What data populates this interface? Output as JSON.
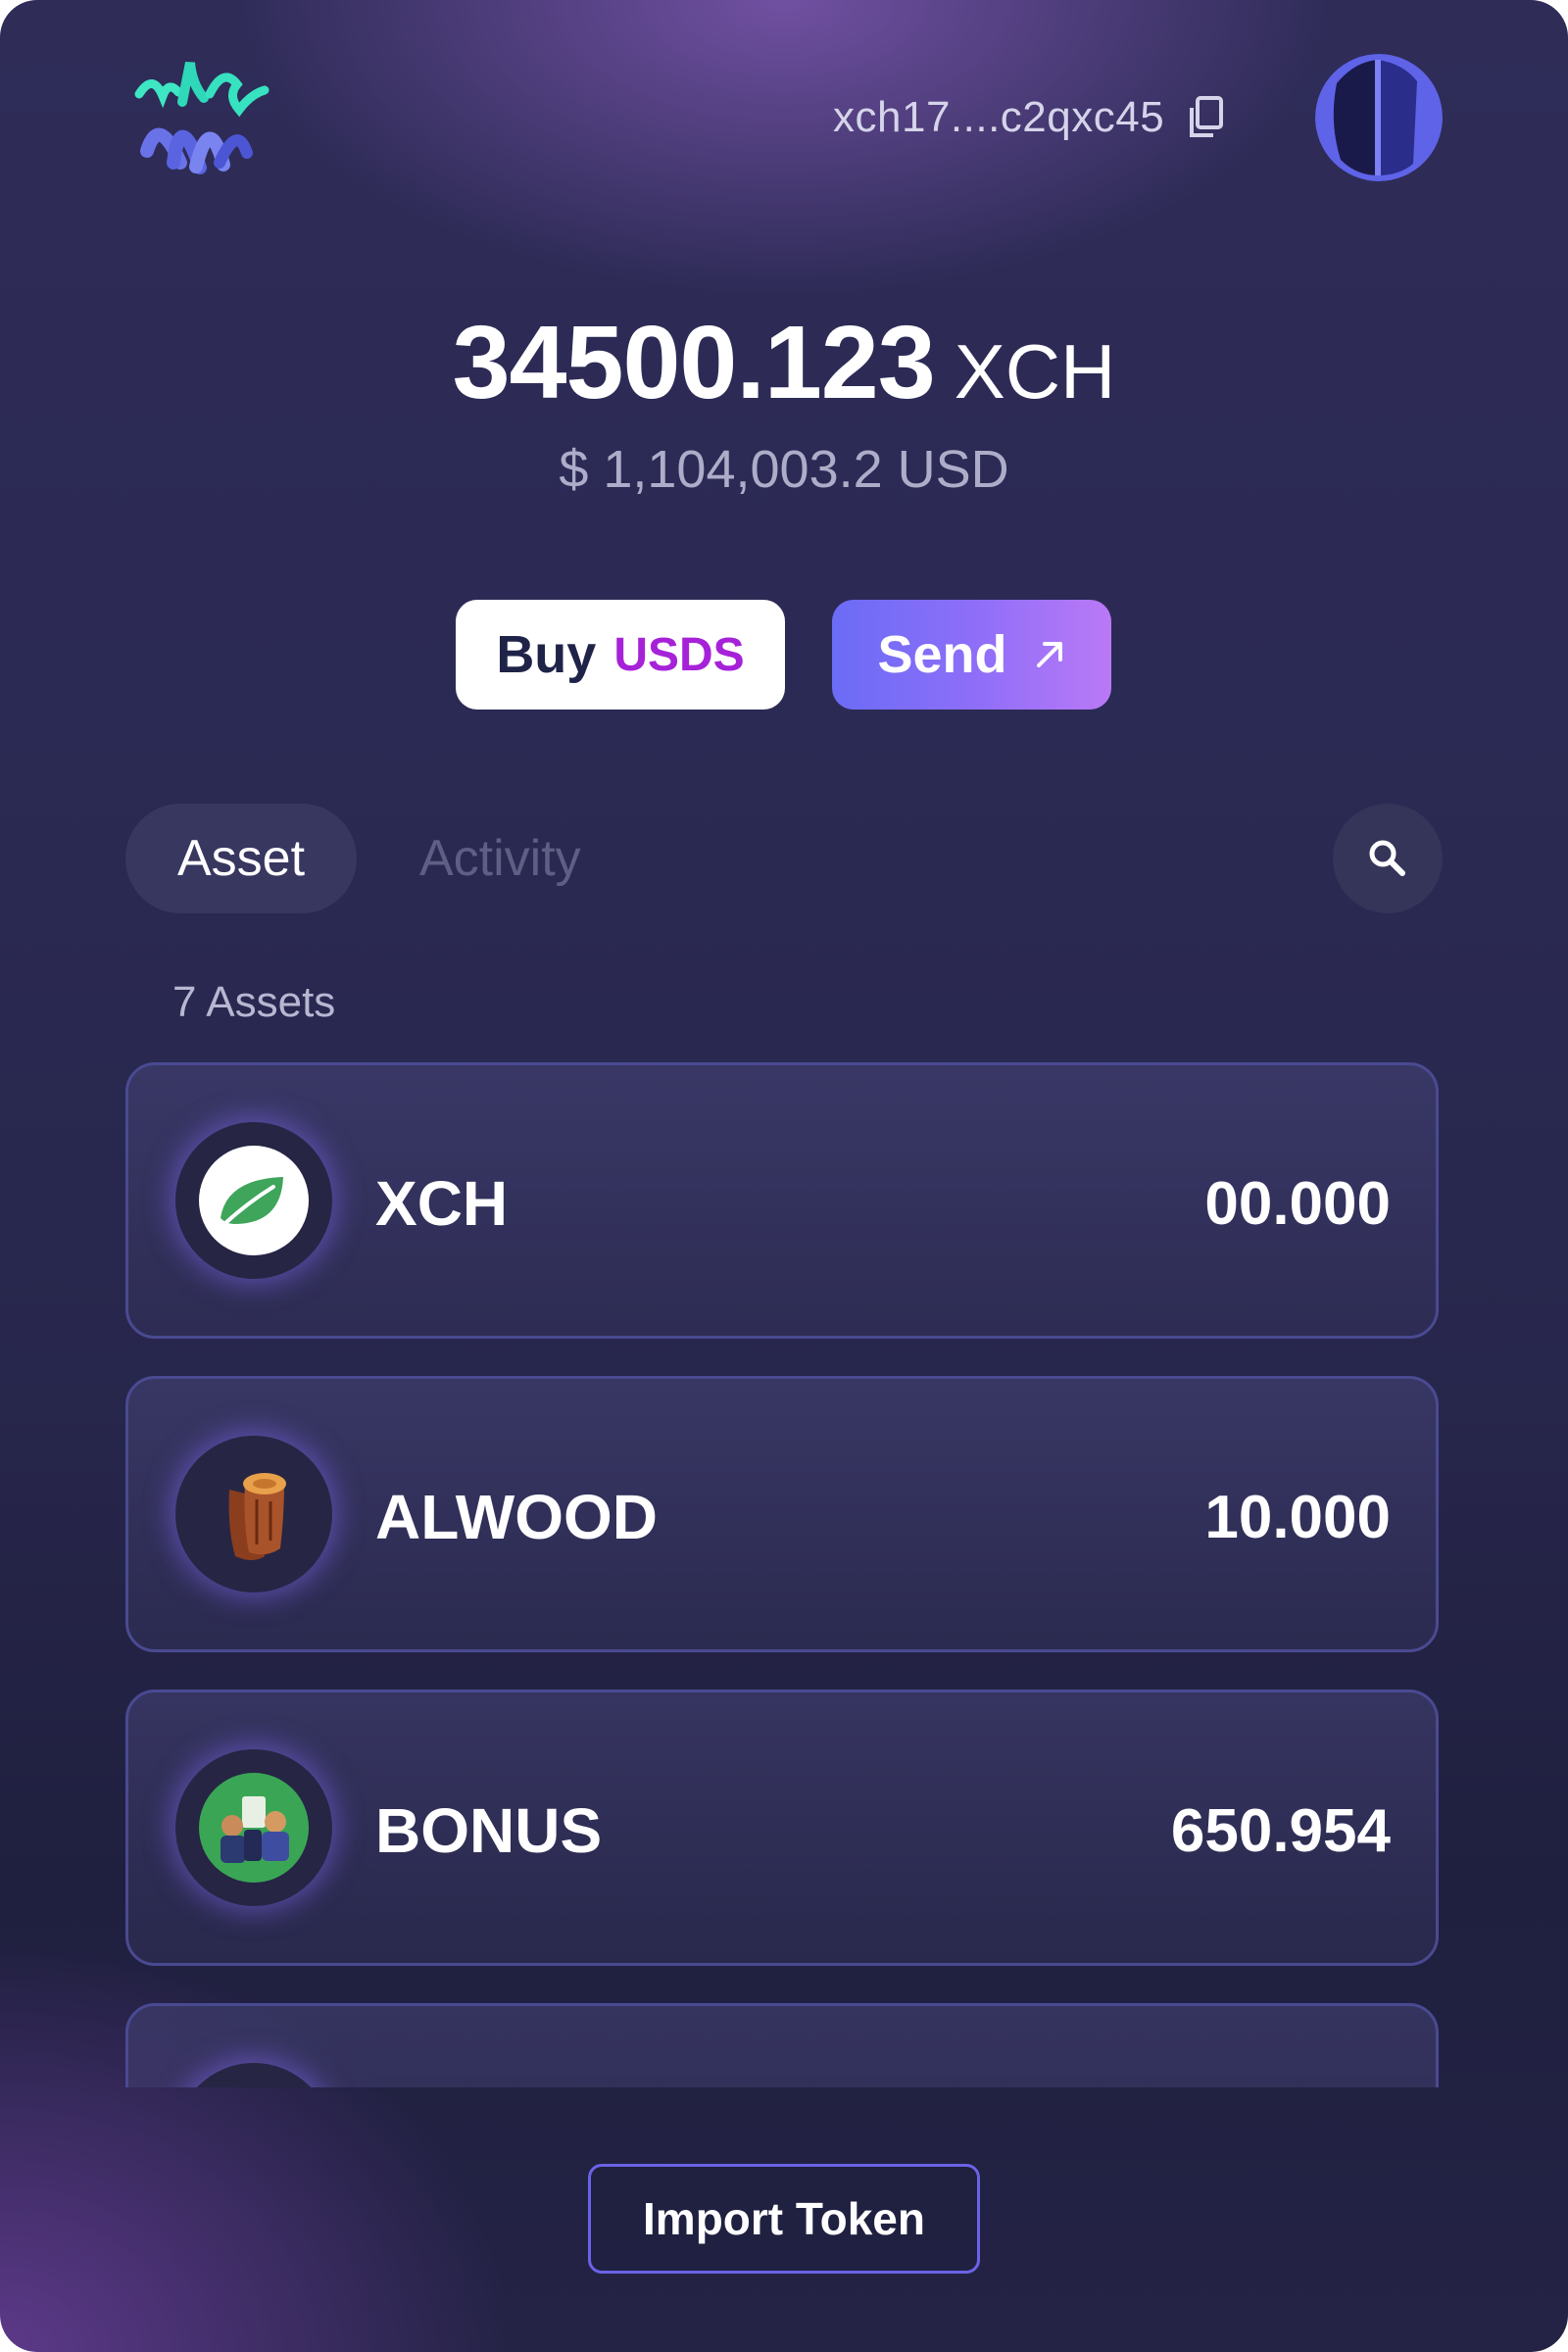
{
  "header": {
    "address": "xch17....c2qxc45",
    "logo_icon": "brand-logo-icon",
    "copy_icon": "copy-icon",
    "avatar_icon": "account-avatar"
  },
  "balance": {
    "amount": "34500.123",
    "unit": "XCH",
    "usd": "$ 1,104,003.2 USD"
  },
  "actions": {
    "buy_label": "Buy",
    "buy_token": "USDS",
    "send_label": "Send",
    "send_icon": "arrow-up-right-icon"
  },
  "tabs": [
    {
      "label": "Asset",
      "active": true
    },
    {
      "label": "Activity",
      "active": false
    }
  ],
  "search_icon": "search-icon",
  "asset_count": "7 Assets",
  "assets": [
    {
      "name": "XCH",
      "amount": "00.000",
      "icon": "chia-leaf-icon"
    },
    {
      "name": "ALWOOD",
      "amount": "10.000",
      "icon": "wood-log-icon"
    },
    {
      "name": "BONUS",
      "amount": "650.954",
      "icon": "bonus-token-icon"
    }
  ],
  "import_label": "Import Token",
  "colors": {
    "accent": "#8d6ef8",
    "buy_token": "#a622d8",
    "card_border": "#4a4a92",
    "background": "#27264b"
  }
}
